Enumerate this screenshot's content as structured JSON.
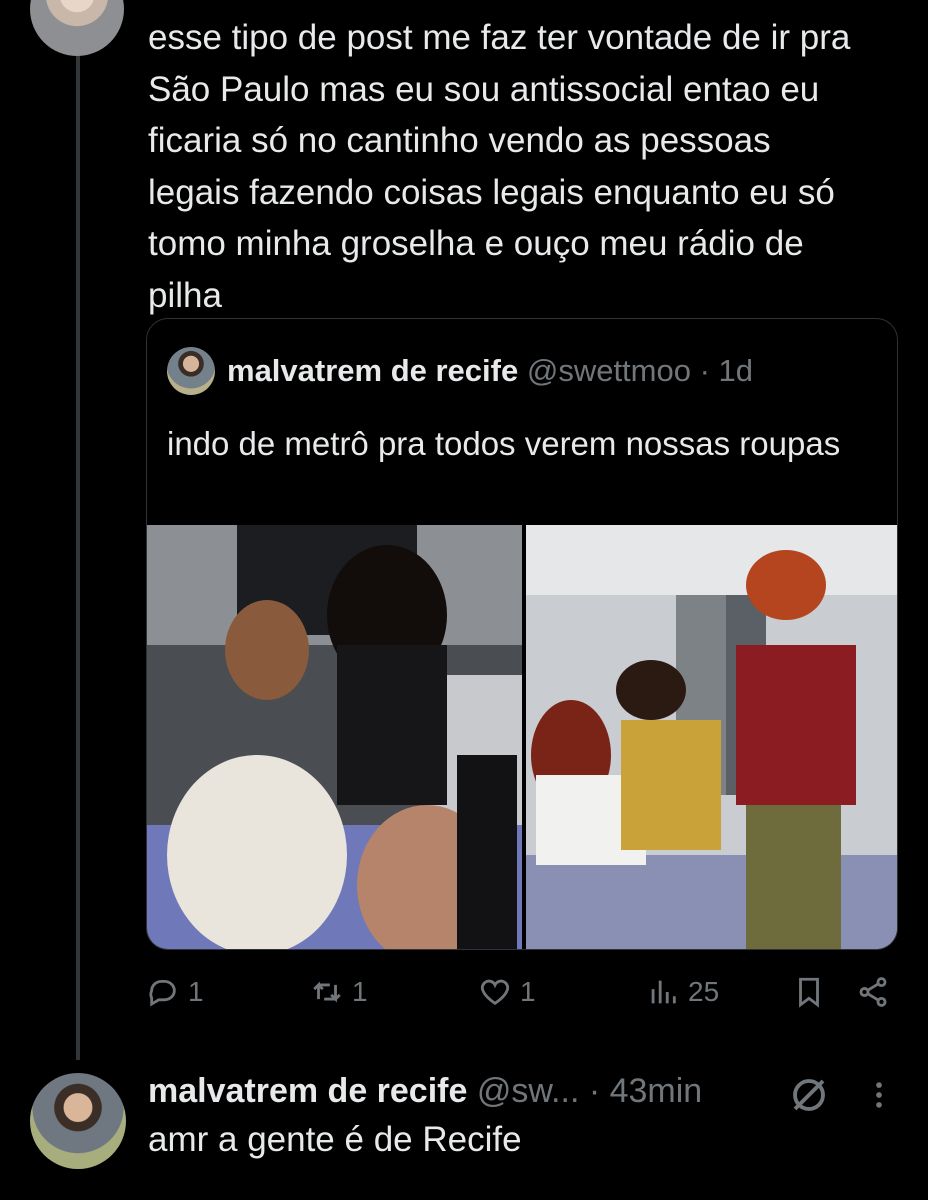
{
  "tweet": {
    "text": "esse tipo de post me faz ter vontade de ir pra\nSão Paulo mas eu sou antissocial entao eu\nficaria só no cantinho vendo as pessoas\nlegais fazendo coisas legais enquanto eu só\ntomo minha groselha e ouço meu rádio de\npilha"
  },
  "quote": {
    "name": "malvatrem de recife",
    "handle": "@swettmoo",
    "time": " · 1d",
    "text": "indo de metrô pra todos verem nossas roupas"
  },
  "actions": {
    "replies": "1",
    "reposts": "1",
    "likes": "1",
    "views": "25"
  },
  "reply": {
    "name": "malvatrem de recife",
    "handle": "@sw...",
    "time": " · 43min",
    "text": "amr a gente é de Recife"
  },
  "icons": {
    "reply": "reply-icon",
    "repost": "repost-icon",
    "like": "heart-icon",
    "views": "views-icon",
    "bookmark": "bookmark-icon",
    "share": "share-icon",
    "mute": "mute-icon",
    "more": "more-icon"
  },
  "colors": {
    "background": "#000000",
    "text": "#e7e9ea",
    "secondary": "#71767b",
    "border": "#2f3336"
  }
}
